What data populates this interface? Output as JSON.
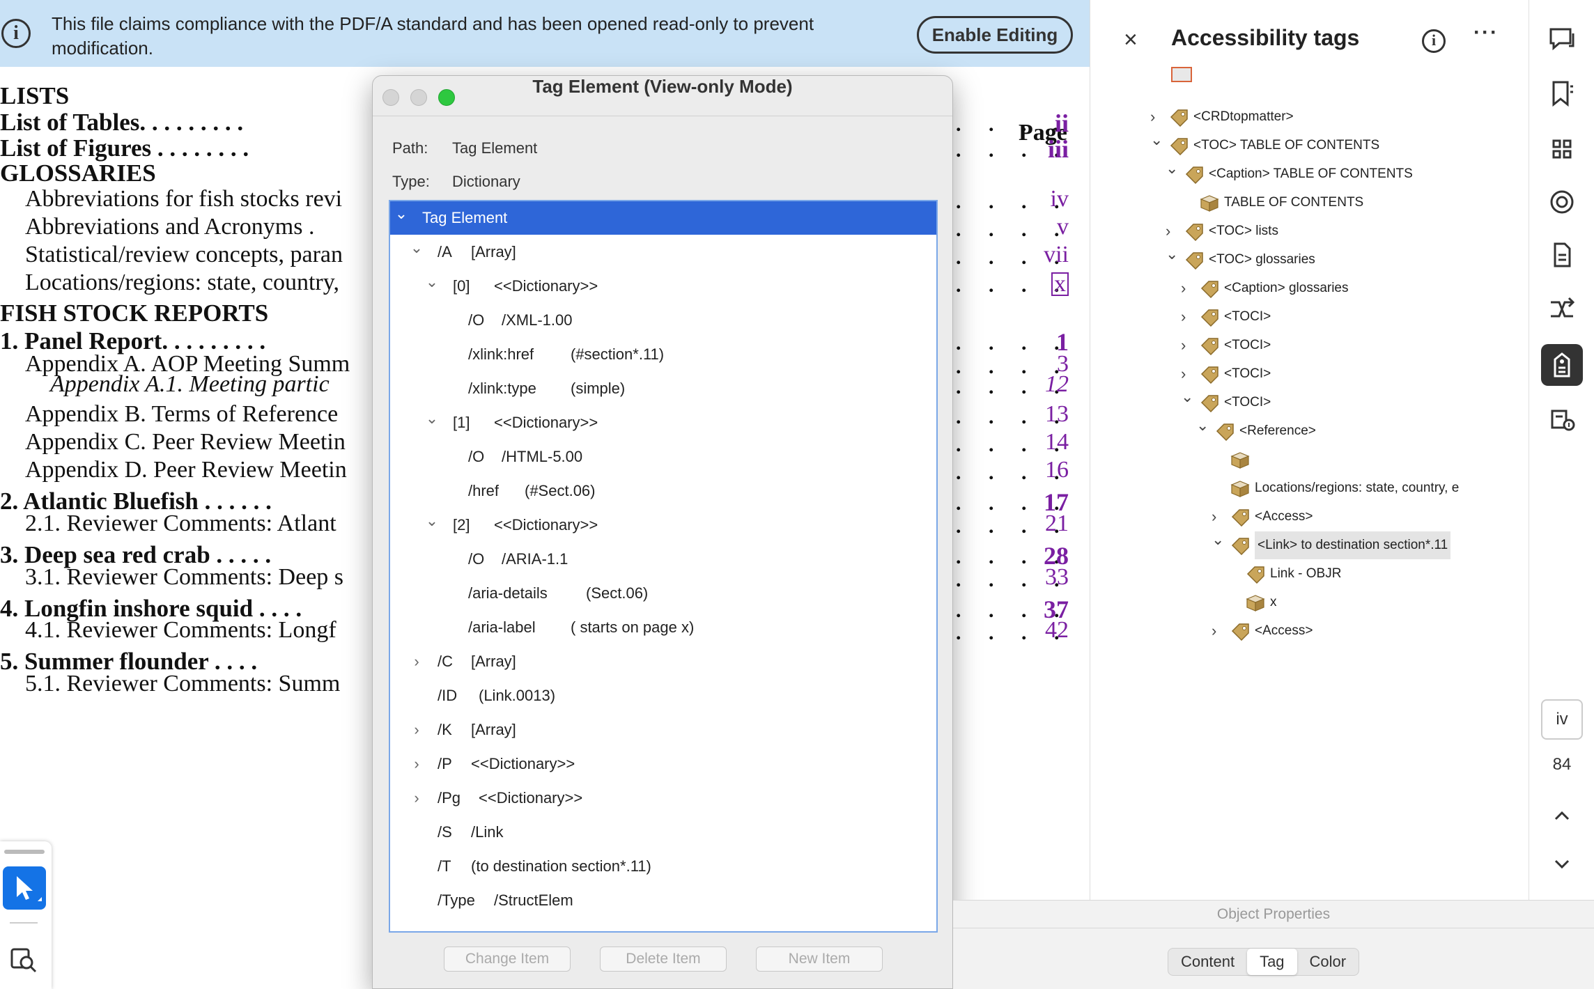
{
  "banner": {
    "text": "This file claims compliance with the PDF/A standard and has been opened read-only to prevent modification.",
    "button": "Enable Editing"
  },
  "toc": {
    "page_heading": "Page",
    "entries": [
      {
        "text": "LISTS",
        "style": "h",
        "page": ""
      },
      {
        "text": "List of Tables. . . . . . . . .",
        "style": "b",
        "page": "ii",
        "pstyle": "bold"
      },
      {
        "text": "List of Figures . . . . . . . .",
        "style": "b",
        "page": "iii",
        "pstyle": "bold"
      },
      {
        "text": "GLOSSARIES",
        "style": "h",
        "page": ""
      },
      {
        "text": "Abbreviations for fish stocks revi",
        "style": "n",
        "page": "iv",
        "pstyle": "reg"
      },
      {
        "text": "Abbreviations and Acronyms .",
        "style": "n",
        "page": "v",
        "pstyle": "reg"
      },
      {
        "text": "Statistical/review concepts, paran",
        "style": "n",
        "page": "vii",
        "pstyle": "reg"
      },
      {
        "text": "Locations/regions: state, country,",
        "style": "n",
        "page": "x",
        "pstyle": "boxed"
      },
      {
        "text": "FISH STOCK REPORTS",
        "style": "h",
        "page": ""
      },
      {
        "text": "1. Panel Report. . . . . . . . .",
        "style": "b",
        "page": "1",
        "pstyle": "bold"
      },
      {
        "text": "Appendix A. AOP Meeting Summ",
        "style": "n",
        "page": "3",
        "pstyle": "reg"
      },
      {
        "text": "Appendix A.1. Meeting partic",
        "style": "i",
        "page": "12",
        "pstyle": "it"
      },
      {
        "text": "Appendix B. Terms of Reference",
        "style": "n",
        "page": "13",
        "pstyle": "reg"
      },
      {
        "text": "Appendix C. Peer Review Meetin",
        "style": "n",
        "page": "14",
        "pstyle": "reg"
      },
      {
        "text": "Appendix D. Peer Review Meetin",
        "style": "n",
        "page": "16",
        "pstyle": "reg"
      },
      {
        "text": "2. Atlantic Bluefish . . . . . .",
        "style": "b",
        "page": "17",
        "pstyle": "bold"
      },
      {
        "text": "2.1. Reviewer Comments: Atlant",
        "style": "n",
        "page": "21",
        "pstyle": "reg"
      },
      {
        "text": "3. Deep sea red crab . . . . .",
        "style": "b",
        "page": "28",
        "pstyle": "bold"
      },
      {
        "text": "3.1. Reviewer Comments: Deep s",
        "style": "n",
        "page": "33",
        "pstyle": "reg"
      },
      {
        "text": "4. Longfin inshore squid . . . .",
        "style": "b",
        "page": "37",
        "pstyle": "bold"
      },
      {
        "text": "4.1. Reviewer Comments: Longf",
        "style": "n",
        "page": "42",
        "pstyle": "reg"
      },
      {
        "text": "5. Summer flounder . . . .",
        "style": "b",
        "page": "",
        "pstyle": "bold"
      },
      {
        "text": "5.1. Reviewer Comments: Summ",
        "style": "n",
        "page": "",
        "pstyle": "reg"
      }
    ]
  },
  "dialog": {
    "title": "Tag Element  (View-only Mode)",
    "path_label": "Path:",
    "path_value": "Tag Element",
    "type_label": "Type:",
    "type_value": "Dictionary",
    "rows": [
      {
        "level": 0,
        "caret": "down",
        "key": "Tag Element",
        "val": "",
        "selected": true
      },
      {
        "level": 1,
        "caret": "down",
        "key": "/A",
        "val": "[Array]"
      },
      {
        "level": 2,
        "caret": "down",
        "key": "[0]",
        "val": "<<Dictionary>>"
      },
      {
        "level": 3,
        "caret": "",
        "key": "/O",
        "val": "/XML-1.00"
      },
      {
        "level": 3,
        "caret": "",
        "key": "/xlink:href",
        "val": "(#section*.11)"
      },
      {
        "level": 3,
        "caret": "",
        "key": "/xlink:type",
        "val": "(simple)"
      },
      {
        "level": 2,
        "caret": "down",
        "key": "[1]",
        "val": "<<Dictionary>>"
      },
      {
        "level": 3,
        "caret": "",
        "key": "/O",
        "val": "/HTML-5.00"
      },
      {
        "level": 3,
        "caret": "",
        "key": "/href",
        "val": "(#Sect.06)"
      },
      {
        "level": 2,
        "caret": "down",
        "key": "[2]",
        "val": "<<Dictionary>>"
      },
      {
        "level": 3,
        "caret": "",
        "key": "/O",
        "val": "/ARIA-1.1"
      },
      {
        "level": 3,
        "caret": "",
        "key": "/aria-details",
        "val": "(Sect.06)"
      },
      {
        "level": 3,
        "caret": "",
        "key": "/aria-label",
        "val": "( starts on page x)"
      },
      {
        "level": 1,
        "caret": "right",
        "key": "/C",
        "val": "[Array]"
      },
      {
        "level": 1,
        "caret": "",
        "key": "/ID",
        "val": "(Link.0013)"
      },
      {
        "level": 1,
        "caret": "right",
        "key": "/K",
        "val": "[Array]"
      },
      {
        "level": 1,
        "caret": "right",
        "key": "/P",
        "val": "<<Dictionary>>"
      },
      {
        "level": 1,
        "caret": "right",
        "key": "/Pg",
        "val": "<<Dictionary>>"
      },
      {
        "level": 1,
        "caret": "",
        "key": "/S",
        "val": "/Link"
      },
      {
        "level": 1,
        "caret": "",
        "key": "/T",
        "val": "(to destination section*.11)"
      },
      {
        "level": 1,
        "caret": "",
        "key": "/Type",
        "val": "/StructElem"
      }
    ],
    "buttons": [
      "Change Item",
      "Delete Item",
      "New Item"
    ]
  },
  "panel": {
    "title": "Accessibility tags",
    "close": "×",
    "more": "···",
    "info": "i",
    "tags": [
      {
        "level": 2,
        "caret": "right",
        "icon": "tag",
        "label": "<CRDtopmatter>"
      },
      {
        "level": 2,
        "caret": "down",
        "icon": "tag",
        "label": "<TOC> TABLE OF CONTENTS"
      },
      {
        "level": 3,
        "caret": "down",
        "icon": "tag",
        "label": "<Caption> TABLE OF CONTENTS"
      },
      {
        "level": 4,
        "caret": "",
        "icon": "box",
        "label": "TABLE OF CONTENTS"
      },
      {
        "level": 3,
        "caret": "right",
        "icon": "tag",
        "label": "<TOC> lists"
      },
      {
        "level": 3,
        "caret": "down",
        "icon": "tag",
        "label": "<TOC> glossaries"
      },
      {
        "level": 4,
        "caret": "right",
        "icon": "tag",
        "label": "<Caption> glossaries"
      },
      {
        "level": 4,
        "caret": "right",
        "icon": "tag",
        "label": "<TOCI>"
      },
      {
        "level": 4,
        "caret": "right",
        "icon": "tag",
        "label": "<TOCI>"
      },
      {
        "level": 4,
        "caret": "right",
        "icon": "tag",
        "label": "<TOCI>"
      },
      {
        "level": 4,
        "caret": "down",
        "icon": "tag",
        "label": "<TOCI>"
      },
      {
        "level": 5,
        "caret": "down",
        "icon": "tag",
        "label": "<Reference>"
      },
      {
        "level": 6,
        "caret": "",
        "icon": "box",
        "label": ""
      },
      {
        "level": 6,
        "caret": "",
        "icon": "box",
        "label": "Locations/regions: state, country, e"
      },
      {
        "level": 6,
        "caret": "right",
        "icon": "tag",
        "label": "<Access>"
      },
      {
        "level": 6,
        "caret": "down",
        "icon": "tag",
        "label": "<Link> to destination section*.11",
        "highlight": true
      },
      {
        "level": 7,
        "caret": "",
        "icon": "tag",
        "label": "Link - OBJR"
      },
      {
        "level": 7,
        "caret": "",
        "icon": "box",
        "label": "x"
      },
      {
        "level": 6,
        "caret": "right",
        "icon": "tag",
        "label": "<Access>"
      }
    ]
  },
  "object_properties": {
    "title": "Object Properties",
    "tabs": [
      "Content",
      "Tag",
      "Color"
    ],
    "active_tab": "Tag"
  },
  "rail": {
    "current_page": "iv",
    "total_pages": "84",
    "icons": [
      "comment-icon",
      "bookmark-icon",
      "thumbnails-icon",
      "target-icon",
      "page-icon",
      "reorder-icon",
      "accessibility-tags-icon",
      "reading-order-icon"
    ]
  },
  "colors": {
    "banner_bg": "#c9e2f6",
    "selection": "#2e66d8",
    "page_number": "#7a1fa2",
    "select_tool": "#1473e6"
  }
}
